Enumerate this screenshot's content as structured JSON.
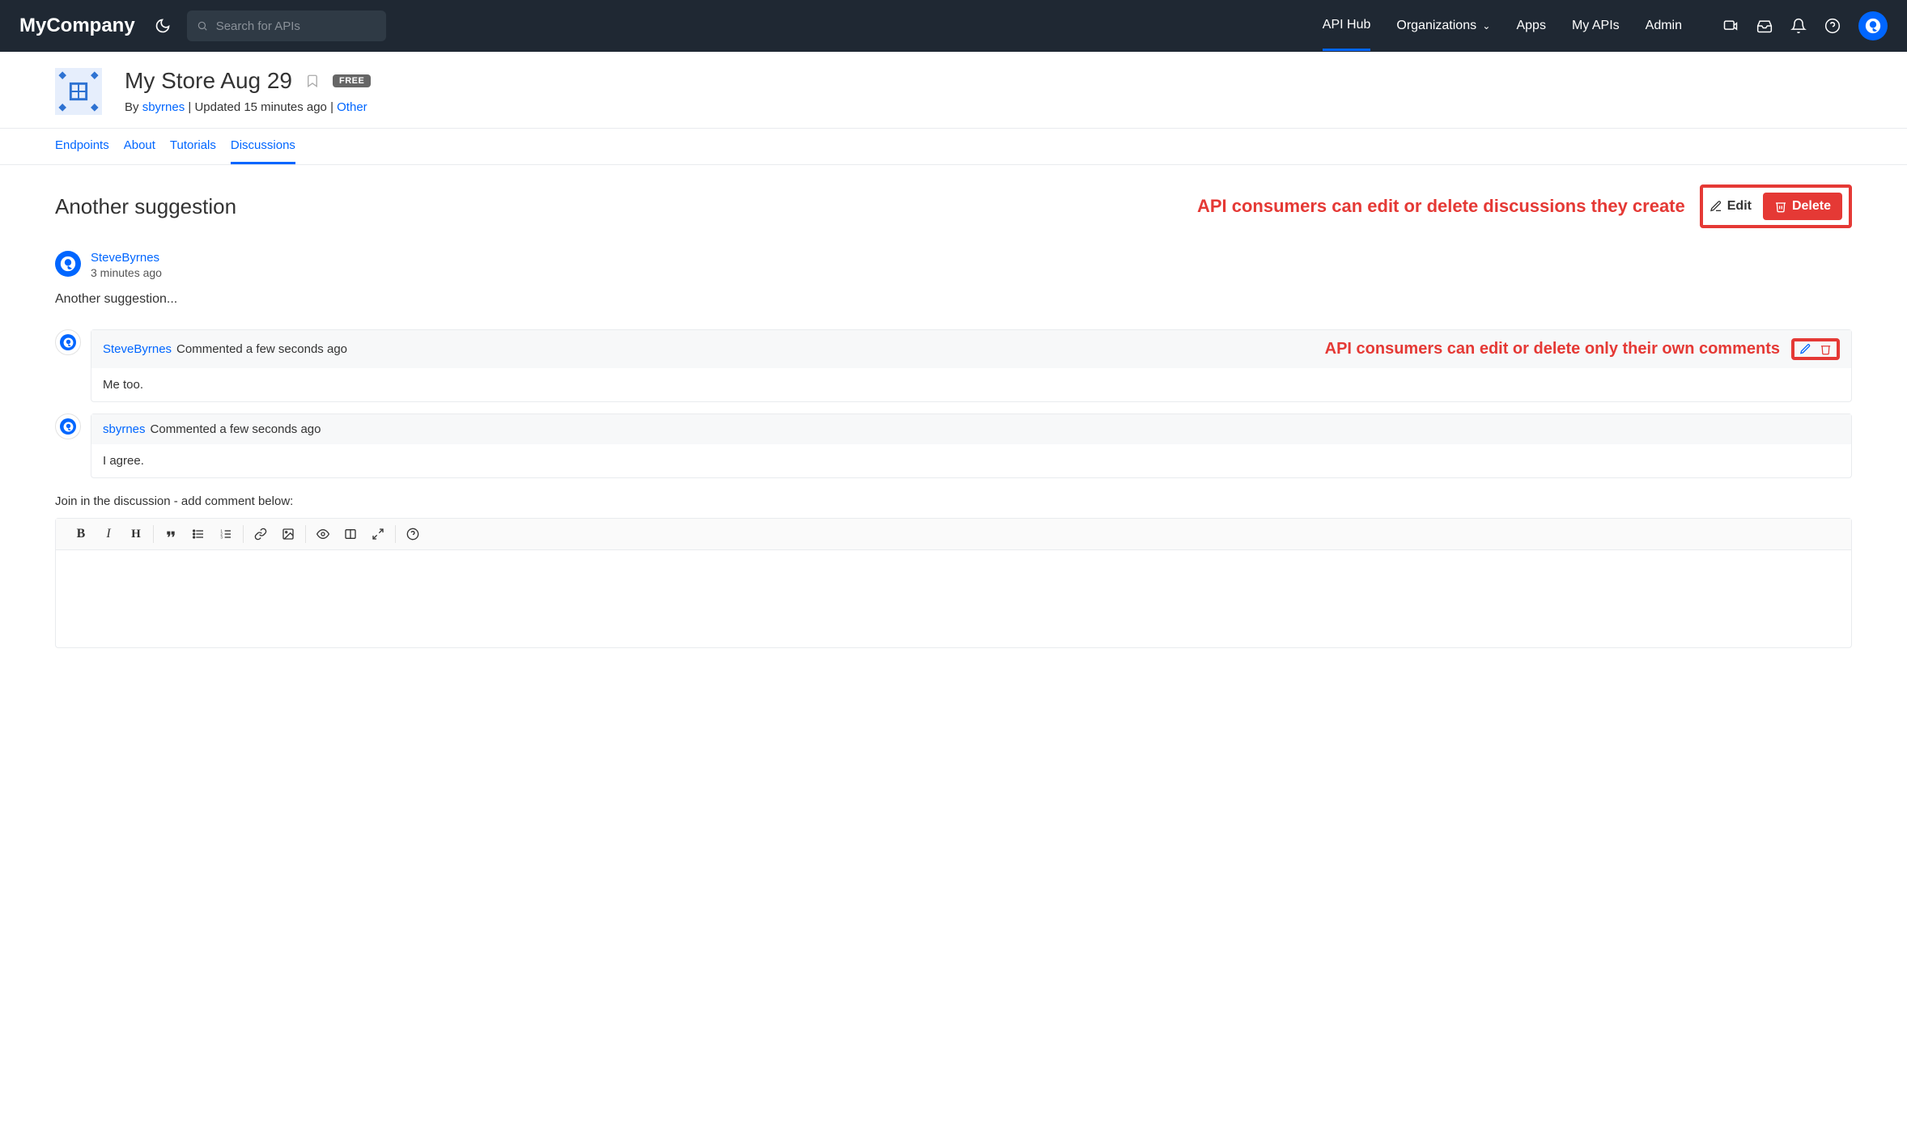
{
  "brand": "MyCompany",
  "search": {
    "placeholder": "Search for APIs"
  },
  "nav": {
    "api_hub": "API Hub",
    "organizations": "Organizations",
    "apps": "Apps",
    "my_apis": "My APIs",
    "admin": "Admin"
  },
  "api": {
    "title": "My Store Aug 29",
    "badge": "FREE",
    "by_prefix": "By ",
    "author": "sbyrnes",
    "updated": " | Updated 15 minutes ago | ",
    "category": "Other"
  },
  "tabs": {
    "endpoints": "Endpoints",
    "about": "About",
    "tutorials": "Tutorials",
    "discussions": "Discussions"
  },
  "discussion": {
    "title": "Another suggestion",
    "annotation1": "API consumers can edit or delete discussions they create",
    "edit": "Edit",
    "delete": "Delete",
    "author": "SteveByrnes",
    "time": "3 minutes ago",
    "body": "Another suggestion..."
  },
  "comments": [
    {
      "author": "SteveByrnes",
      "meta": "Commented a few seconds ago",
      "annotation": "API consumers can edit or delete only their own comments",
      "body": "Me too.",
      "own": true
    },
    {
      "author": "sbyrnes",
      "meta": "Commented a few seconds ago",
      "body": "I agree.",
      "own": false
    }
  ],
  "join_prompt": "Join in the discussion - add comment below:"
}
